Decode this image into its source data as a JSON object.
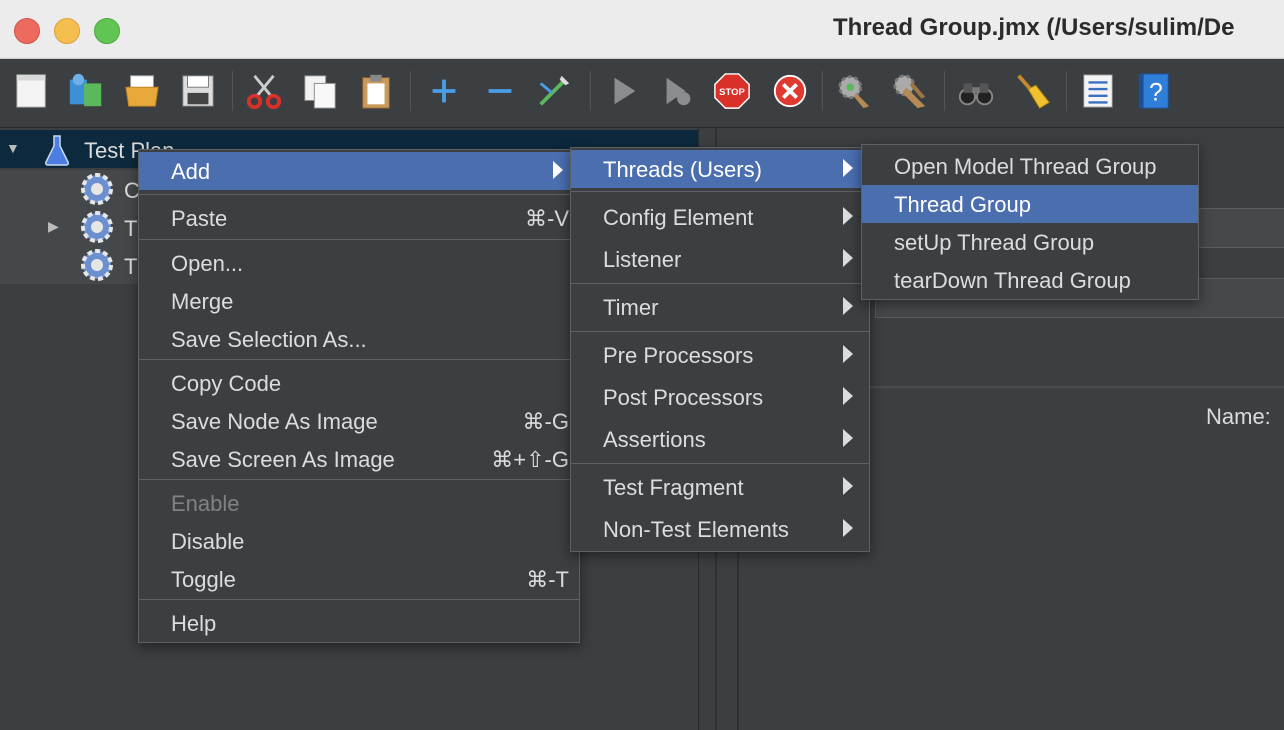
{
  "window": {
    "title": "Thread Group.jmx (/Users/sulim/De"
  },
  "toolbar": {
    "buttons": [
      {
        "icon": "new-document-icon"
      },
      {
        "icon": "templates-icon"
      },
      {
        "icon": "open-folder-icon"
      },
      {
        "icon": "save-icon"
      },
      {
        "icon": "cut-icon"
      },
      {
        "icon": "copy-icon"
      },
      {
        "icon": "paste-icon"
      },
      {
        "icon": "expand-all-icon"
      },
      {
        "icon": "collapse-all-icon"
      },
      {
        "icon": "toggle-icon"
      },
      {
        "icon": "start-icon"
      },
      {
        "icon": "start-no-pauses-icon"
      },
      {
        "icon": "stop-icon"
      },
      {
        "icon": "shutdown-icon"
      },
      {
        "icon": "clear-icon"
      },
      {
        "icon": "clear-all-icon"
      },
      {
        "icon": "search-binoculars-icon"
      },
      {
        "icon": "reset-search-broom-icon"
      },
      {
        "icon": "function-helper-icon"
      },
      {
        "icon": "help-icon"
      }
    ]
  },
  "tree": {
    "root": "Test Plan",
    "children": [
      {
        "label": "C"
      },
      {
        "label": "T"
      },
      {
        "label": "T"
      }
    ]
  },
  "panel": {
    "name_label": "Name:"
  },
  "context_menu": {
    "items": [
      {
        "label": "Add",
        "submenu": true
      },
      {
        "label": "Paste",
        "shortcut": "⌘-V"
      },
      {
        "label": "Open..."
      },
      {
        "label": "Merge"
      },
      {
        "label": "Save Selection As..."
      },
      {
        "label": "Copy Code"
      },
      {
        "label": "Save Node As Image",
        "shortcut": "⌘-G"
      },
      {
        "label": "Save Screen As Image",
        "shortcut": "⌘+⇧-G"
      },
      {
        "label": "Enable",
        "disabled": true
      },
      {
        "label": "Disable"
      },
      {
        "label": "Toggle",
        "shortcut": "⌘-T"
      },
      {
        "label": "Help"
      }
    ]
  },
  "add_submenu": {
    "items": [
      {
        "label": "Threads (Users)"
      },
      {
        "label": "Config Element"
      },
      {
        "label": "Listener"
      },
      {
        "label": "Timer"
      },
      {
        "label": "Pre Processors"
      },
      {
        "label": "Post Processors"
      },
      {
        "label": "Assertions"
      },
      {
        "label": "Test Fragment"
      },
      {
        "label": "Non-Test Elements"
      }
    ]
  },
  "threads_submenu": {
    "items": [
      {
        "label": "Open Model Thread Group"
      },
      {
        "label": "Thread Group"
      },
      {
        "label": "setUp Thread Group"
      },
      {
        "label": "tearDown Thread Group"
      }
    ]
  },
  "colors": {
    "menu_highlight": "#4b6eaf",
    "background": "#3c3f41",
    "tree_selection": "#0d293e"
  }
}
